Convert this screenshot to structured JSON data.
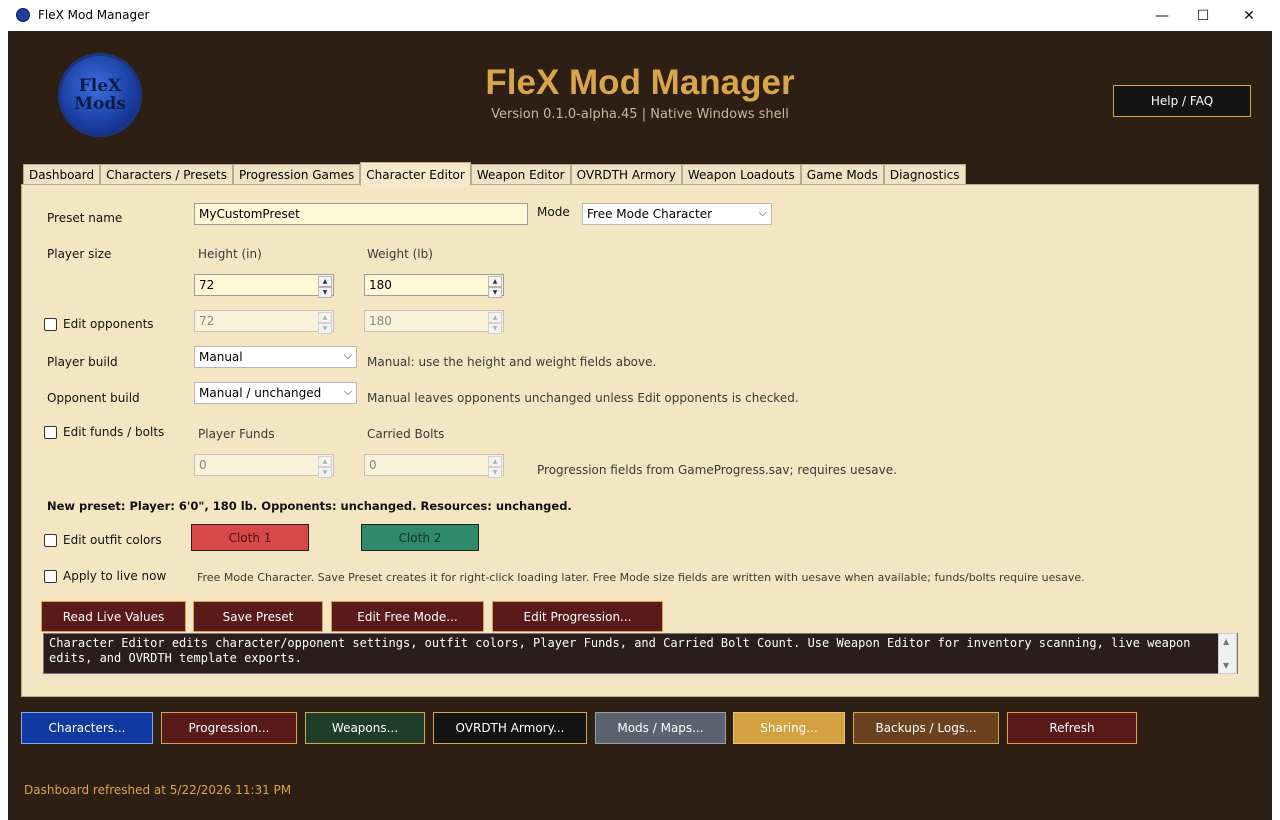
{
  "window": {
    "title": "FleX Mod Manager",
    "minimize_glyph": "—",
    "maximize_glyph": "☐",
    "close_glyph": "✕"
  },
  "header": {
    "logo_text_line1": "FleX",
    "logo_text_line2": "Mods",
    "title": "FleX Mod Manager",
    "version": "Version 0.1.0-alpha.45 | Native Windows shell",
    "help_label": "Help / FAQ"
  },
  "tabs": [
    {
      "label": "Dashboard"
    },
    {
      "label": "Characters / Presets"
    },
    {
      "label": "Progression Games"
    },
    {
      "label": "Character Editor"
    },
    {
      "label": "Weapon Editor"
    },
    {
      "label": "OVRDTH Armory"
    },
    {
      "label": "Weapon Loadouts"
    },
    {
      "label": "Game Mods"
    },
    {
      "label": "Diagnostics"
    }
  ],
  "editor": {
    "preset_name_label": "Preset name",
    "preset_name_value": "MyCustomPreset",
    "mode_label": "Mode",
    "mode_value": "Free Mode Character",
    "player_size_label": "Player size",
    "height_label": "Height (in)",
    "weight_label": "Weight (lb)",
    "height_value": "72",
    "weight_value": "180",
    "edit_opponents_label": "Edit opponents",
    "opp_height_value": "72",
    "opp_weight_value": "180",
    "player_build_label": "Player build",
    "player_build_value": "Manual",
    "player_build_hint": "Manual: use the height and weight fields above.",
    "opponent_build_label": "Opponent build",
    "opponent_build_value": "Manual / unchanged",
    "opponent_build_hint": "Manual leaves opponents unchanged unless Edit opponents is checked.",
    "edit_funds_label": "Edit funds / bolts",
    "player_funds_label": "Player Funds",
    "carried_bolts_label": "Carried Bolts",
    "funds_value": "0",
    "bolts_value": "0",
    "progression_hint": "Progression fields from GameProgress.sav; requires uesave.",
    "summary": "New preset: Player: 6'0\", 180 lb. Opponents: unchanged. Resources: unchanged.",
    "edit_outfit_label": "Edit outfit colors",
    "cloth1_label": "Cloth 1",
    "cloth2_label": "Cloth 2",
    "cloth1_color": "#d94848",
    "cloth2_color": "#2e8a6a",
    "apply_live_label": "Apply to live now",
    "apply_live_hint": "Free Mode Character. Save Preset creates it for right-click loading later. Free Mode size fields are written with uesave when available; funds/bolts require uesave.",
    "buttons": {
      "read_live": "Read Live Values",
      "save_preset": "Save Preset",
      "edit_free_mode": "Edit Free Mode...",
      "edit_progression": "Edit Progression..."
    },
    "log_text": "Character Editor edits character/opponent settings, outfit colors, Player Funds, and Carried Bolt Count. Use Weapon Editor for inventory scanning, live weapon edits, and OVRDTH template exports."
  },
  "bottom_buttons": [
    {
      "label": "Characters...",
      "bg": "#0f3aa0",
      "border": "#8aa6e6"
    },
    {
      "label": "Progression...",
      "bg": "#5a1a1a",
      "border": "#d8a54b"
    },
    {
      "label": "Weapons...",
      "bg": "#1f3d28",
      "border": "#d8a54b"
    },
    {
      "label": "OVRDTH Armory...",
      "bg": "#141414",
      "border": "#d8a54b"
    },
    {
      "label": "Mods / Maps...",
      "bg": "#5a6470",
      "border": "#9aa2aa"
    },
    {
      "label": "Sharing...",
      "bg": "#d3a13f",
      "border": "#e8c57a"
    },
    {
      "label": "Backups / Logs...",
      "bg": "#6a4220",
      "border": "#d8a54b"
    },
    {
      "label": "Refresh",
      "bg": "#5a1a1a",
      "border": "#d8a54b"
    }
  ],
  "status": "Dashboard refreshed at 5/22/2026 11:31 PM"
}
